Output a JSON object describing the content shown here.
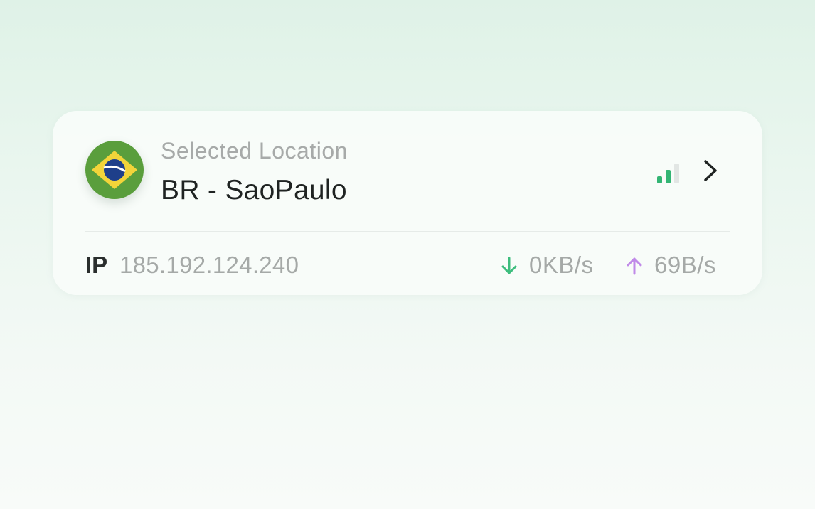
{
  "location": {
    "caption": "Selected Location",
    "name": "BR - SaoPaulo",
    "flag_icon": "brazil-flag-icon",
    "signal_icon": "signal-strength-icon",
    "chevron_icon": "chevron-right-icon"
  },
  "connection": {
    "ip_label": "IP",
    "ip_value": "185.192.124.240",
    "download_icon": "arrow-down-icon",
    "download_speed": "0KB/s",
    "upload_icon": "arrow-up-icon",
    "upload_speed": "69B/s"
  },
  "colors": {
    "download": "#3dbd7d",
    "upload": "#c08ae8",
    "signal_active": "#33b574",
    "signal_inactive": "#e2e6e4",
    "flag_green": "#5a9e3c",
    "flag_yellow": "#f2d43a",
    "flag_blue": "#1e3f8a"
  },
  "signal": {
    "bars_total": 3,
    "bars_active": 2
  }
}
